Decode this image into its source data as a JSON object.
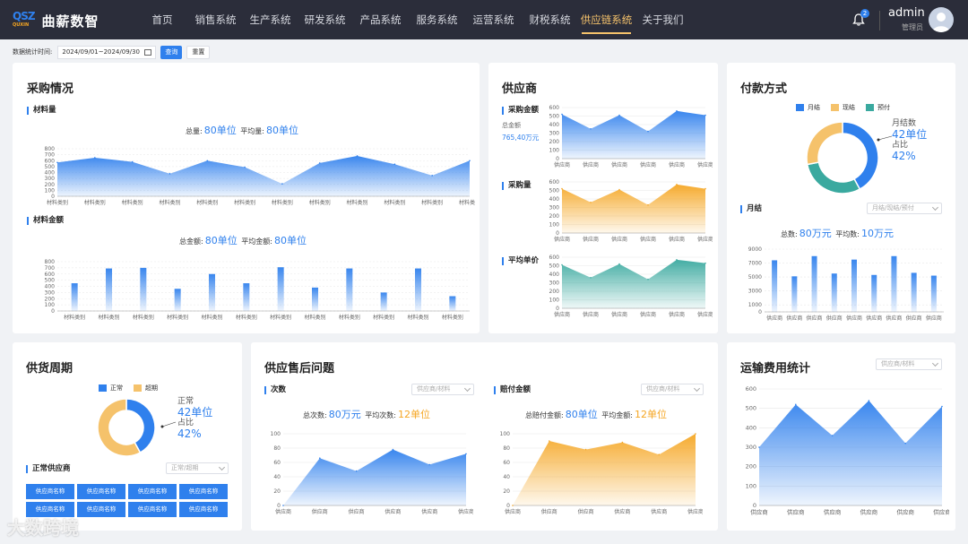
{
  "app": {
    "logo_mark": "QSZ",
    "logo_sub": "QUXIN",
    "title": "曲薪数智"
  },
  "nav": [
    "首页",
    "销售系统",
    "生产系统",
    "研发系统",
    "产品系统",
    "服务系统",
    "运营系统",
    "财税系统",
    "供应链系统",
    "关于我们"
  ],
  "nav_active": 8,
  "notifications": "2",
  "user": {
    "name": "admin",
    "role": "管理员"
  },
  "filter": {
    "label": "数据统计时间:",
    "date_range": "2024/09/01~2024/09/30",
    "query": "查询",
    "reset": "重置"
  },
  "procurement": {
    "title": "采购情况",
    "qty_section": "材料量",
    "qty_total_label": "总量:",
    "qty_total": "80单位",
    "qty_avg_label": "平均量:",
    "qty_avg": "80单位",
    "amt_section": "材料金额",
    "amt_total_label": "总金额:",
    "amt_total": "80单位",
    "amt_avg_label": "平均金额:",
    "amt_avg": "80单位"
  },
  "supplier": {
    "title": "供应商",
    "amt_section": "采购金额",
    "amt_total_label": "总金额",
    "amt_total": "765,40万元",
    "qty_section": "采购量",
    "price_section": "平均单价"
  },
  "payment": {
    "title": "付款方式",
    "legend": [
      "月结",
      "现结",
      "预付"
    ],
    "callout_name": "月结数",
    "callout_value": "42单位",
    "callout_ratio_label": "占比",
    "callout_ratio": "42%",
    "sub_section": "月结",
    "select_placeholder": "月结/现结/预付",
    "total_label": "总数:",
    "total": "80万元",
    "avg_label": "平均数:",
    "avg": "10万元"
  },
  "cycle": {
    "title": "供货周期",
    "legend": [
      "正常",
      "超期"
    ],
    "callout_name": "正常",
    "callout_value": "42单位",
    "callout_ratio_label": "占比",
    "callout_ratio": "42%",
    "sub_section": "正常供应商",
    "select_placeholder": "正常/超期",
    "supplier_buttons": [
      "供应商名称",
      "供应商名称",
      "供应商名称",
      "供应商名称",
      "供应商名称",
      "供应商名称",
      "供应商名称",
      "供应商名称"
    ]
  },
  "aftersale": {
    "title": "供应售后问题",
    "count_section": "次数",
    "count_select": "供应商/材料",
    "count_total_label": "总次数:",
    "count_total": "80万元",
    "count_avg_label": "平均次数:",
    "count_avg": "12单位",
    "comp_section": "赔付金额",
    "comp_select": "供应商/材料",
    "comp_total_label": "总赔付金额:",
    "comp_total": "80单位",
    "comp_avg_label": "平均金额:",
    "comp_avg": "12单位"
  },
  "freight": {
    "title": "运输费用统计",
    "select_placeholder": "供应商/材料"
  },
  "watermark": "大数跨境",
  "colors": {
    "primary": "#2f80ed",
    "orange": "#f5a623",
    "teal": "#3aa99f",
    "nav_bg": "#2b2d3a",
    "nav_active": "#f5c26b"
  },
  "chart_data": [
    {
      "id": "material-qty",
      "type": "area",
      "categories": [
        "材料类别",
        "材料类别",
        "材料类别",
        "材料类别",
        "材料类别",
        "材料类别",
        "材料类别",
        "材料类别",
        "材料类别",
        "材料类别",
        "材料类别",
        "材料类别"
      ],
      "values": [
        570,
        650,
        580,
        380,
        600,
        490,
        210,
        560,
        680,
        540,
        350,
        600
      ],
      "yticks": [
        0,
        100,
        200,
        300,
        400,
        500,
        600,
        700,
        800
      ],
      "ylim": [
        0,
        800
      ]
    },
    {
      "id": "material-amt",
      "type": "bar",
      "categories": [
        "材料类别",
        "材料类别",
        "材料类别",
        "材料类别",
        "材料类别",
        "材料类别",
        "材料类别",
        "材料类别",
        "材料类别",
        "材料类别",
        "材料类别",
        "材料类别"
      ],
      "values": [
        450,
        690,
        700,
        360,
        600,
        450,
        710,
        380,
        690,
        300,
        690,
        240
      ],
      "yticks": [
        0,
        100,
        200,
        300,
        400,
        500,
        600,
        700,
        800
      ],
      "ylim": [
        0,
        800
      ]
    },
    {
      "id": "supplier-amt",
      "type": "area",
      "categories": [
        "供应商",
        "供应商",
        "供应商",
        "供应商",
        "供应商",
        "供应商"
      ],
      "values": [
        520,
        350,
        510,
        320,
        560,
        510
      ],
      "yticks": [
        0,
        100,
        200,
        300,
        400,
        500,
        600
      ],
      "ylim": [
        0,
        600
      ]
    },
    {
      "id": "supplier-qty",
      "type": "area",
      "categories": [
        "供应商",
        "供应商",
        "供应商",
        "供应商",
        "供应商",
        "供应商"
      ],
      "values": [
        520,
        360,
        510,
        330,
        570,
        520
      ],
      "yticks": [
        0,
        100,
        200,
        300,
        400,
        500,
        600
      ],
      "ylim": [
        0,
        600
      ]
    },
    {
      "id": "supplier-price",
      "type": "area",
      "categories": [
        "供应商",
        "供应商",
        "供应商",
        "供应商",
        "供应商",
        "供应商"
      ],
      "values": [
        510,
        360,
        520,
        340,
        570,
        530
      ],
      "yticks": [
        0,
        100,
        200,
        300,
        400,
        500,
        600
      ],
      "ylim": [
        0,
        600
      ]
    },
    {
      "id": "payment-pie",
      "type": "pie",
      "categories": [
        "月结",
        "现结",
        "预付"
      ],
      "values": [
        42,
        30,
        28
      ]
    },
    {
      "id": "monthly-bar",
      "type": "bar",
      "categories": [
        "供应商",
        "供应商",
        "供应商",
        "供应商",
        "供应商",
        "供应商",
        "供应商",
        "供应商",
        "供应商"
      ],
      "values": [
        7400,
        5100,
        8000,
        5500,
        7500,
        5300,
        8000,
        5600,
        5200
      ],
      "yticks": [
        0,
        1000,
        3000,
        5000,
        7000,
        9000
      ],
      "ylim": [
        0,
        9000
      ]
    },
    {
      "id": "cycle-pie",
      "type": "pie",
      "categories": [
        "正常",
        "超期"
      ],
      "values": [
        42,
        58
      ]
    },
    {
      "id": "aftersale-count",
      "type": "area",
      "categories": [
        "供应商",
        "供应商",
        "供应商",
        "供应商",
        "供应商",
        "供应商"
      ],
      "values": [
        0,
        66,
        48,
        78,
        57,
        72
      ],
      "yticks": [
        0,
        20,
        40,
        60,
        80,
        100
      ],
      "ylim": [
        0,
        100
      ]
    },
    {
      "id": "aftersale-comp",
      "type": "area",
      "categories": [
        "供应商",
        "供应商",
        "供应商",
        "供应商",
        "供应商",
        "供应商"
      ],
      "values": [
        0,
        90,
        78,
        88,
        71,
        100
      ],
      "yticks": [
        0,
        20,
        40,
        60,
        80,
        100
      ],
      "ylim": [
        0,
        100
      ]
    },
    {
      "id": "freight",
      "type": "area",
      "categories": [
        "供应商",
        "供应商",
        "供应商",
        "供应商",
        "供应商",
        "供应商"
      ],
      "values": [
        300,
        520,
        360,
        540,
        320,
        510
      ],
      "yticks": [
        0,
        100,
        200,
        300,
        400,
        500,
        600
      ],
      "ylim": [
        0,
        600
      ]
    }
  ]
}
